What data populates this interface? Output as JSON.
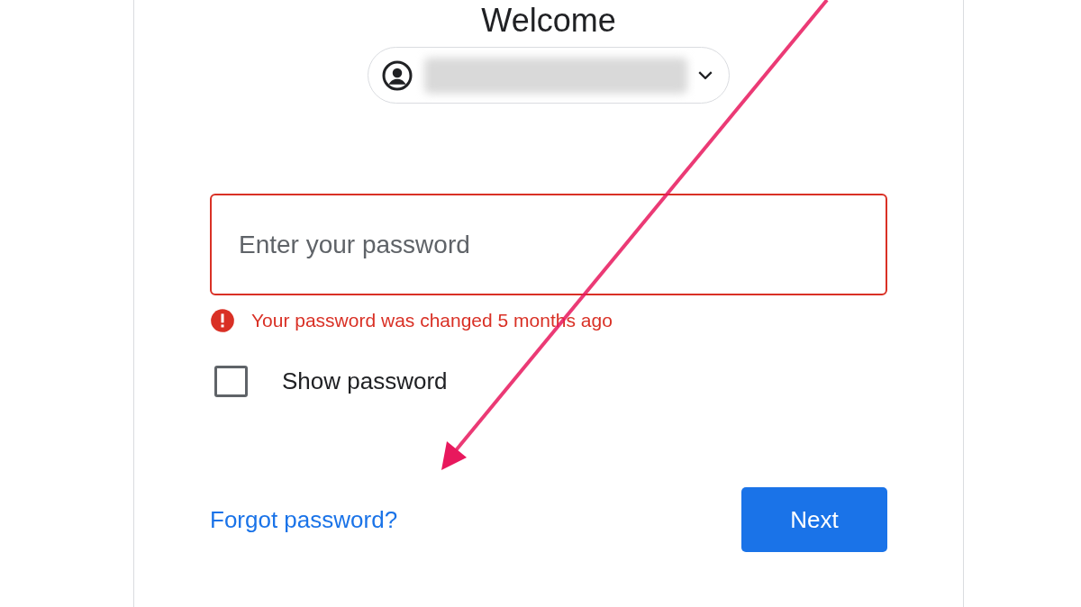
{
  "heading": "Welcome",
  "password_field": {
    "placeholder": "Enter your password",
    "error": true
  },
  "error_message": "Your password was changed 5 months ago",
  "show_password": {
    "label": "Show password",
    "checked": false
  },
  "forgot_link": "Forgot password?",
  "next_button": "Next",
  "annotation": {
    "kind": "arrow"
  }
}
